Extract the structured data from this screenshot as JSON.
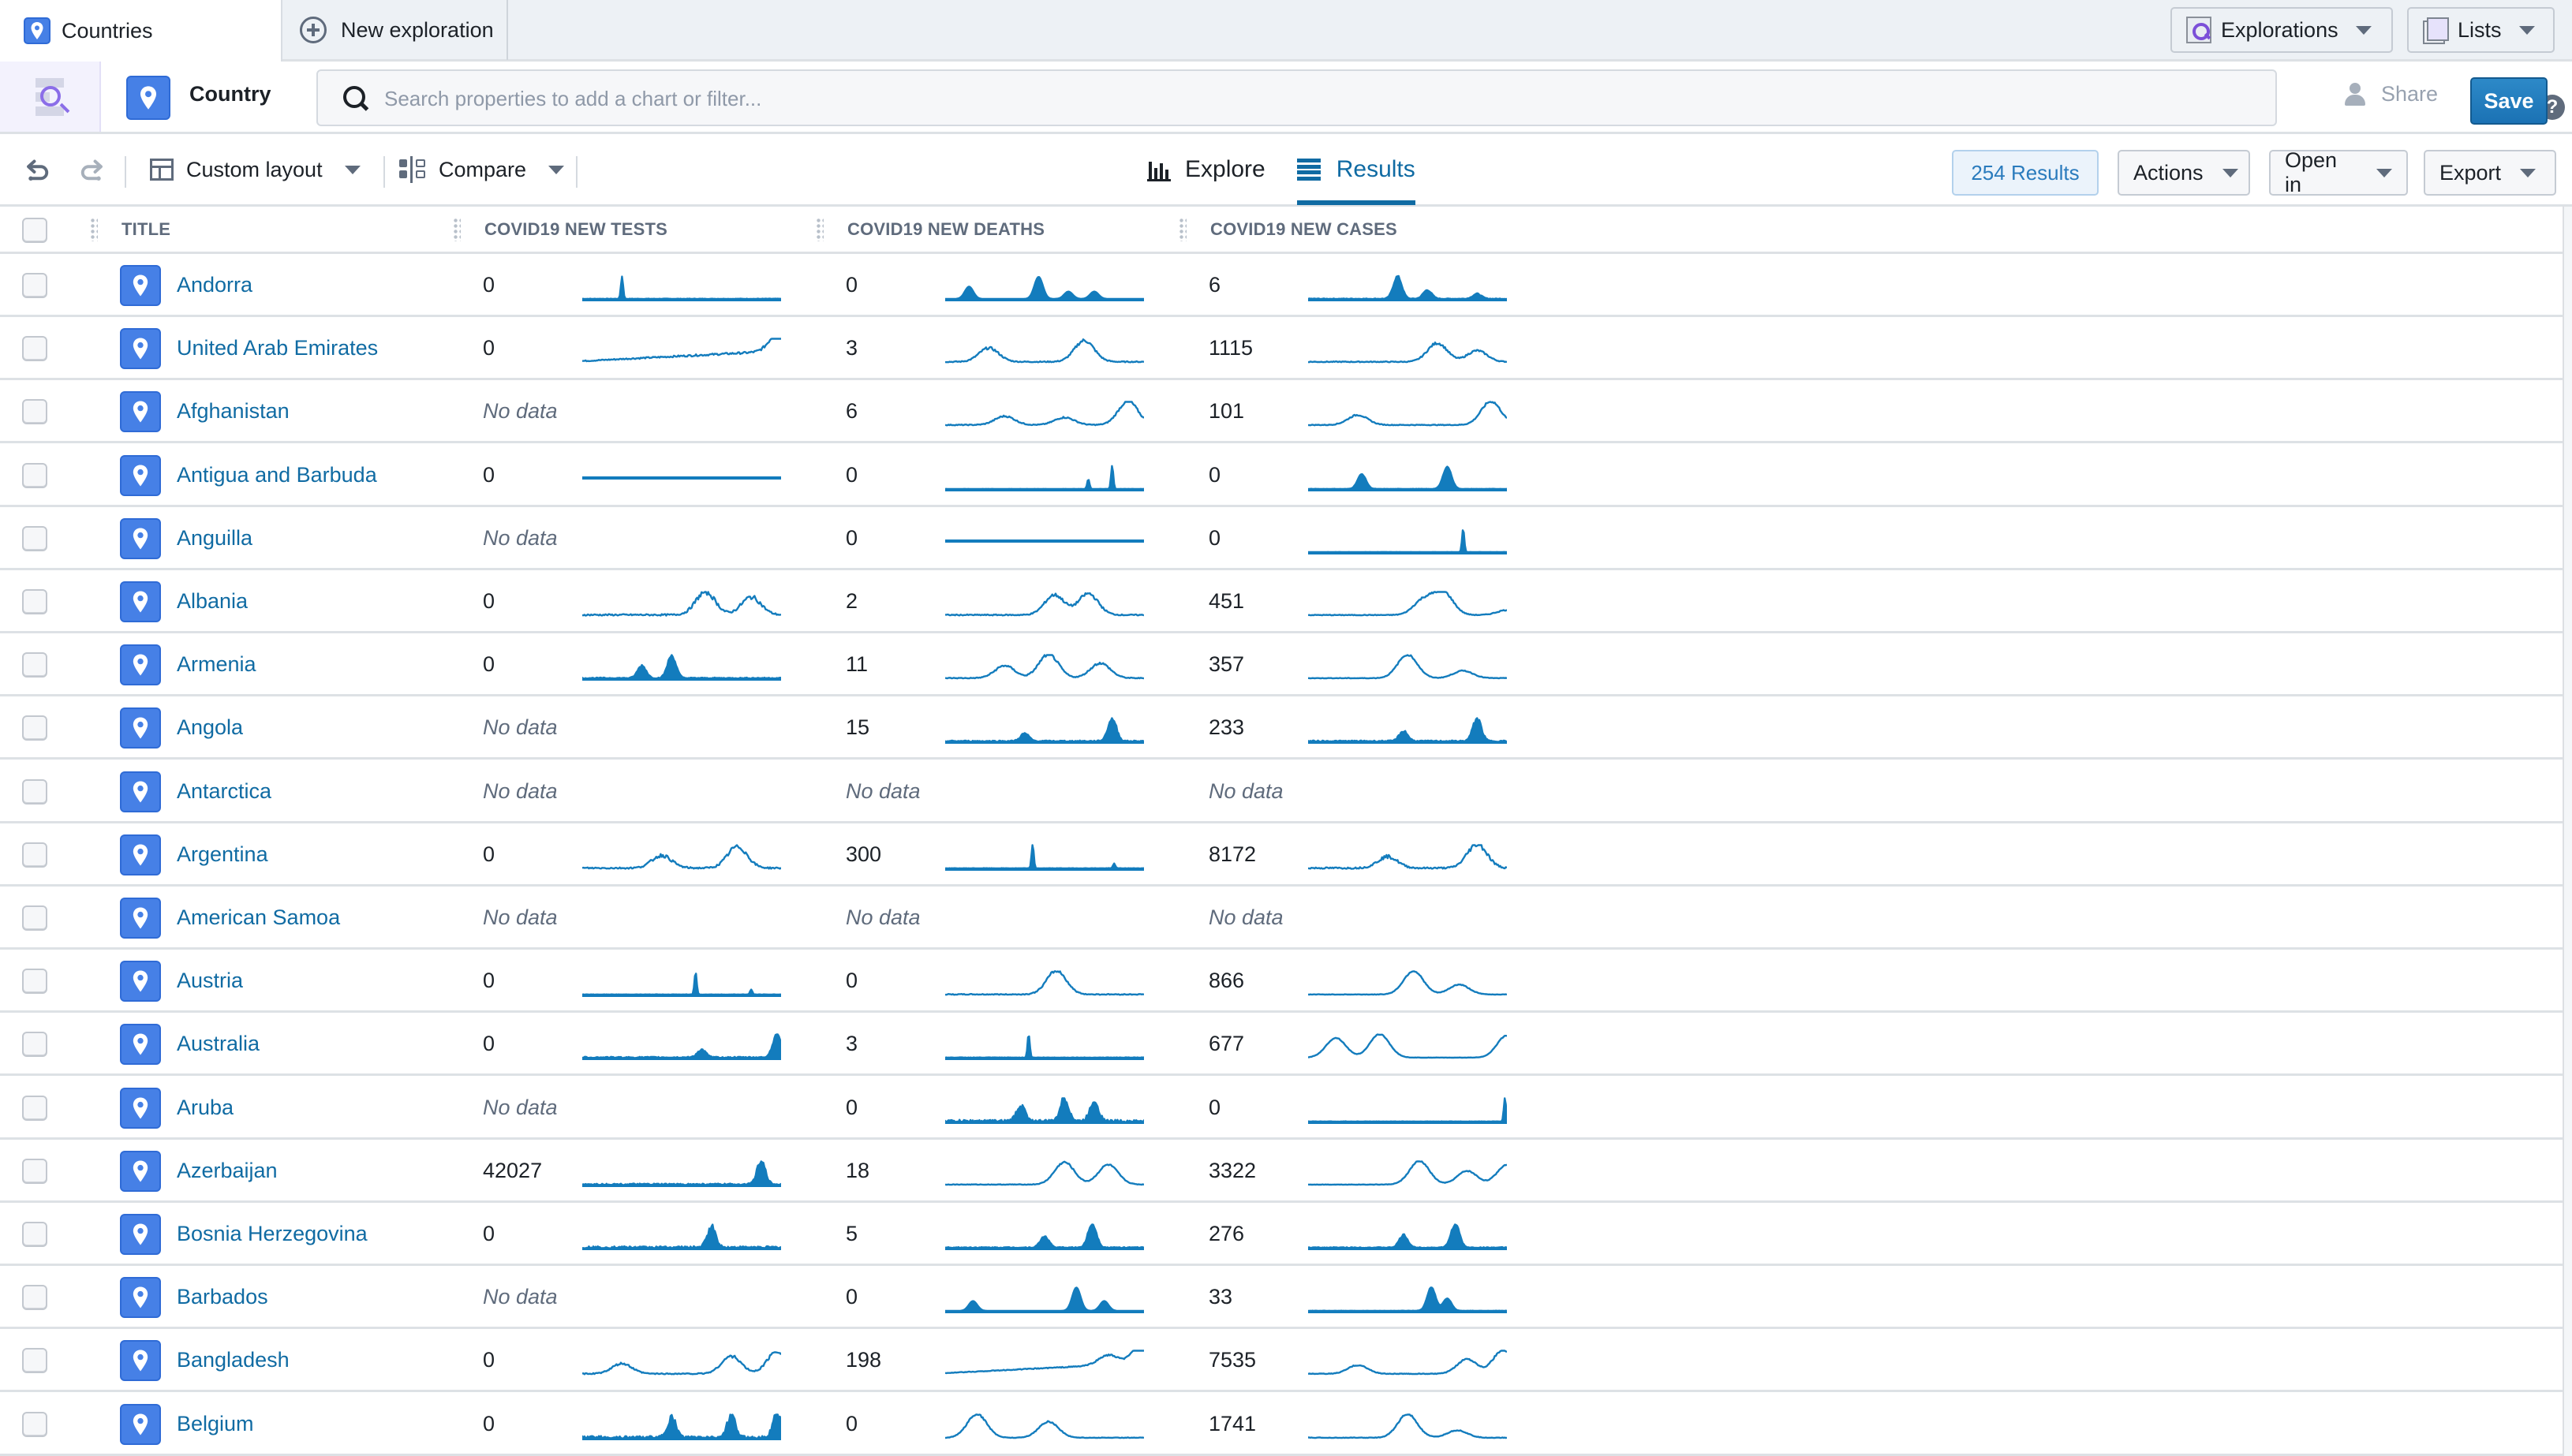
{
  "tabs": {
    "active": {
      "label": "Countries",
      "icon": "map-pin-icon"
    },
    "new": {
      "label": "New exploration",
      "icon": "plus-circle-icon"
    }
  },
  "top_right": {
    "explorations": {
      "label": "Explorations",
      "icon": "exploration-icon"
    },
    "lists": {
      "label": "Lists",
      "icon": "lists-icon"
    }
  },
  "header": {
    "object_type": "Country",
    "search_placeholder": "Search properties to add a chart or filter...",
    "search_value": "",
    "help": "?",
    "share_label": "Share",
    "save_label": "Save"
  },
  "toolbar": {
    "layout_label": "Custom layout",
    "compare_label": "Compare",
    "view_tabs": [
      {
        "label": "Explore",
        "icon": "bar-chart-icon",
        "active": false
      },
      {
        "label": "Results",
        "icon": "list-icon",
        "active": true
      }
    ],
    "results_count": "254 Results",
    "actions_label": "Actions",
    "open_in_label": "Open in",
    "export_label": "Export"
  },
  "colors": {
    "accent": "#106ba3",
    "spark": "#137cbd",
    "pin_bg": "#4680e6",
    "save_bg": "#1b72b4"
  },
  "table": {
    "columns": [
      "TITLE",
      "COVID19 NEW TESTS",
      "COVID19 NEW DEATHS",
      "COVID19 NEW CASES"
    ],
    "no_data_label": "No data",
    "rows": [
      {
        "title": "Andorra",
        "tests": "0",
        "deaths": "0",
        "cases": "6",
        "spark": {
          "tests": {
            "style": "spike",
            "peaks": [
              [
                0.2,
                0.9
              ]
            ],
            "noise": 0.05
          },
          "deaths": {
            "style": "bars",
            "peaks": [
              [
                0.12,
                0.5
              ],
              [
                0.47,
                0.9
              ],
              [
                0.62,
                0.3
              ],
              [
                0.75,
                0.3
              ]
            ],
            "noise": 0.0
          },
          "cases": {
            "style": "bars",
            "peaks": [
              [
                0.45,
                0.9
              ],
              [
                0.6,
                0.35
              ],
              [
                0.85,
                0.2
              ]
            ],
            "noise": 0.08
          }
        }
      },
      {
        "title": "United Arab Emirates",
        "tests": "0",
        "deaths": "3",
        "cases": "1115",
        "spark": {
          "tests": {
            "style": "trend",
            "peaks": [
              [
                1.0,
                0.9
              ]
            ],
            "noise": 0.12
          },
          "deaths": {
            "style": "line",
            "peaks": [
              [
                0.22,
                0.55
              ],
              [
                0.7,
                0.85
              ]
            ],
            "noise": 0.12
          },
          "cases": {
            "style": "line",
            "peaks": [
              [
                0.65,
                0.75
              ],
              [
                0.85,
                0.45
              ]
            ],
            "noise": 0.1
          }
        }
      },
      {
        "title": "Afghanistan",
        "tests": null,
        "deaths": "6",
        "cases": "101",
        "spark": {
          "tests": null,
          "deaths": {
            "style": "line",
            "peaks": [
              [
                0.3,
                0.35
              ],
              [
                0.6,
                0.3
              ],
              [
                0.92,
                0.95
              ]
            ],
            "noise": 0.1
          },
          "cases": {
            "style": "line",
            "peaks": [
              [
                0.25,
                0.4
              ],
              [
                0.92,
                0.95
              ]
            ],
            "noise": 0.08
          }
        }
      },
      {
        "title": "Antigua and Barbuda",
        "tests": "0",
        "deaths": "0",
        "cases": "0",
        "spark": {
          "tests": {
            "style": "flat",
            "level": 0.5,
            "peaks": [],
            "noise": 0
          },
          "deaths": {
            "style": "spike",
            "peaks": [
              [
                0.72,
                0.4
              ],
              [
                0.84,
                0.95
              ]
            ],
            "noise": 0.02
          },
          "cases": {
            "style": "bars",
            "peaks": [
              [
                0.27,
                0.6
              ],
              [
                0.7,
                0.9
              ]
            ],
            "noise": 0.03
          }
        }
      },
      {
        "title": "Anguilla",
        "tests": null,
        "deaths": "0",
        "cases": "0",
        "spark": {
          "tests": null,
          "deaths": {
            "style": "flat",
            "level": 0.5,
            "peaks": [],
            "noise": 0
          },
          "cases": {
            "style": "spike",
            "peaks": [
              [
                0.78,
                0.95
              ]
            ],
            "noise": 0.02
          }
        }
      },
      {
        "title": "Albania",
        "tests": "0",
        "deaths": "2",
        "cases": "451",
        "spark": {
          "tests": {
            "style": "line",
            "peaks": [
              [
                0.62,
                0.9
              ],
              [
                0.85,
                0.7
              ]
            ],
            "noise": 0.18
          },
          "deaths": {
            "style": "line",
            "peaks": [
              [
                0.55,
                0.8
              ],
              [
                0.72,
                0.85
              ]
            ],
            "noise": 0.12
          },
          "cases": {
            "style": "line",
            "peaks": [
              [
                0.58,
                0.6
              ],
              [
                0.68,
                0.9
              ],
              [
                1.0,
                0.2
              ]
            ],
            "noise": 0.08
          }
        }
      },
      {
        "title": "Armenia",
        "tests": "0",
        "deaths": "11",
        "cases": "357",
        "spark": {
          "tests": {
            "style": "bars",
            "peaks": [
              [
                0.3,
                0.5
              ],
              [
                0.45,
                0.9
              ]
            ],
            "noise": 0.12
          },
          "deaths": {
            "style": "line",
            "peaks": [
              [
                0.3,
                0.5
              ],
              [
                0.52,
                0.95
              ],
              [
                0.78,
                0.6
              ]
            ],
            "noise": 0.1
          },
          "cases": {
            "style": "line",
            "peaks": [
              [
                0.5,
                0.95
              ],
              [
                0.78,
                0.3
              ]
            ],
            "noise": 0.06
          }
        }
      },
      {
        "title": "Angola",
        "tests": null,
        "deaths": "15",
        "cases": "233",
        "spark": {
          "tests": null,
          "deaths": {
            "style": "bars",
            "peaks": [
              [
                0.4,
                0.3
              ],
              [
                0.84,
                0.9
              ]
            ],
            "noise": 0.15
          },
          "cases": {
            "style": "bars",
            "peaks": [
              [
                0.48,
                0.4
              ],
              [
                0.85,
                0.9
              ]
            ],
            "noise": 0.15
          }
        }
      },
      {
        "title": "Antarctica",
        "tests": null,
        "deaths": null,
        "cases": null,
        "spark": {
          "tests": null,
          "deaths": null,
          "cases": null
        }
      },
      {
        "title": "Argentina",
        "tests": "0",
        "deaths": "300",
        "cases": "8172",
        "spark": {
          "tests": {
            "style": "line",
            "peaks": [
              [
                0.4,
                0.5
              ],
              [
                0.78,
                0.85
              ]
            ],
            "noise": 0.18
          },
          "deaths": {
            "style": "spike",
            "peaks": [
              [
                0.44,
                0.95
              ],
              [
                0.85,
                0.2
              ]
            ],
            "noise": 0.04
          },
          "cases": {
            "style": "line",
            "peaks": [
              [
                0.4,
                0.45
              ],
              [
                0.85,
                0.95
              ]
            ],
            "noise": 0.18
          }
        }
      },
      {
        "title": "American Samoa",
        "tests": null,
        "deaths": null,
        "cases": null,
        "spark": {
          "tests": null,
          "deaths": null,
          "cases": null
        }
      },
      {
        "title": "Austria",
        "tests": "0",
        "deaths": "0",
        "cases": "866",
        "spark": {
          "tests": {
            "style": "spike",
            "peaks": [
              [
                0.57,
                0.9
              ],
              [
                0.85,
                0.2
              ]
            ],
            "noise": 0.04
          },
          "deaths": {
            "style": "line",
            "peaks": [
              [
                0.56,
                0.95
              ]
            ],
            "noise": 0.1
          },
          "cases": {
            "style": "line",
            "peaks": [
              [
                0.53,
                0.95
              ],
              [
                0.76,
                0.4
              ]
            ],
            "noise": 0.05
          }
        }
      },
      {
        "title": "Australia",
        "tests": "0",
        "deaths": "3",
        "cases": "677",
        "spark": {
          "tests": {
            "style": "bars",
            "peaks": [
              [
                0.6,
                0.3
              ],
              [
                0.98,
                0.95
              ]
            ],
            "noise": 0.15
          },
          "deaths": {
            "style": "spike",
            "peaks": [
              [
                0.42,
                0.95
              ]
            ],
            "noise": 0.05
          },
          "cases": {
            "style": "line",
            "peaks": [
              [
                0.14,
                0.8
              ],
              [
                0.36,
                0.95
              ],
              [
                1.0,
                0.9
              ]
            ],
            "noise": 0.03
          }
        }
      },
      {
        "title": "Aruba",
        "tests": null,
        "deaths": "0",
        "cases": "0",
        "spark": {
          "tests": null,
          "deaths": {
            "style": "bars",
            "peaks": [
              [
                0.38,
                0.6
              ],
              [
                0.6,
                0.9
              ],
              [
                0.75,
                0.8
              ]
            ],
            "noise": 0.3
          },
          "cases": {
            "style": "spike",
            "peaks": [
              [
                0.99,
                0.95
              ]
            ],
            "noise": 0.04
          }
        }
      },
      {
        "title": "Azerbaijan",
        "tests": "42027",
        "deaths": "18",
        "cases": "3322",
        "spark": {
          "tests": {
            "style": "bars",
            "peaks": [
              [
                0.9,
                0.9
              ]
            ],
            "noise": 0.18
          },
          "deaths": {
            "style": "line",
            "peaks": [
              [
                0.6,
                0.9
              ],
              [
                0.82,
                0.8
              ]
            ],
            "noise": 0.06
          },
          "cases": {
            "style": "line",
            "peaks": [
              [
                0.56,
                0.95
              ],
              [
                0.8,
                0.55
              ],
              [
                1.0,
                0.8
              ]
            ],
            "noise": 0.05
          }
        }
      },
      {
        "title": "Bosnia Herzegovina",
        "tests": "0",
        "deaths": "5",
        "cases": "276",
        "spark": {
          "tests": {
            "style": "bars",
            "peaks": [
              [
                0.65,
                0.8
              ]
            ],
            "noise": 0.25
          },
          "deaths": {
            "style": "bars",
            "peaks": [
              [
                0.5,
                0.45
              ],
              [
                0.74,
                0.95
              ]
            ],
            "noise": 0.12
          },
          "cases": {
            "style": "bars",
            "peaks": [
              [
                0.48,
                0.5
              ],
              [
                0.74,
                0.95
              ]
            ],
            "noise": 0.1
          }
        }
      },
      {
        "title": "Barbados",
        "tests": null,
        "deaths": "0",
        "cases": "33",
        "spark": {
          "tests": null,
          "deaths": {
            "style": "bars",
            "peaks": [
              [
                0.14,
                0.4
              ],
              [
                0.66,
                0.95
              ],
              [
                0.8,
                0.4
              ]
            ],
            "noise": 0.0
          },
          "cases": {
            "style": "bars",
            "peaks": [
              [
                0.62,
                0.95
              ],
              [
                0.7,
                0.5
              ]
            ],
            "noise": 0.03
          }
        }
      },
      {
        "title": "Bangladesh",
        "tests": "0",
        "deaths": "198",
        "cases": "7535",
        "spark": {
          "tests": {
            "style": "line",
            "peaks": [
              [
                0.2,
                0.4
              ],
              [
                0.75,
                0.7
              ],
              [
                0.98,
                0.9
              ]
            ],
            "noise": 0.12
          },
          "deaths": {
            "style": "trend",
            "peaks": [
              [
                0.82,
                0.4
              ],
              [
                1.0,
                0.95
              ]
            ],
            "noise": 0.06
          },
          "cases": {
            "style": "line",
            "peaks": [
              [
                0.25,
                0.35
              ],
              [
                0.8,
                0.6
              ],
              [
                0.98,
                0.95
              ]
            ],
            "noise": 0.07
          }
        }
      },
      {
        "title": "Belgium",
        "tests": "0",
        "deaths": "0",
        "cases": "1741",
        "spark": {
          "tests": {
            "style": "bars",
            "peaks": [
              [
                0.45,
                0.75
              ],
              [
                0.75,
                0.8
              ],
              [
                0.98,
                0.9
              ]
            ],
            "noise": 0.3
          },
          "deaths": {
            "style": "line",
            "peaks": [
              [
                0.16,
                0.95
              ],
              [
                0.52,
                0.65
              ]
            ],
            "noise": 0.06
          },
          "cases": {
            "style": "line",
            "peaks": [
              [
                0.5,
                0.95
              ],
              [
                0.75,
                0.3
              ]
            ],
            "noise": 0.06
          }
        }
      }
    ]
  }
}
